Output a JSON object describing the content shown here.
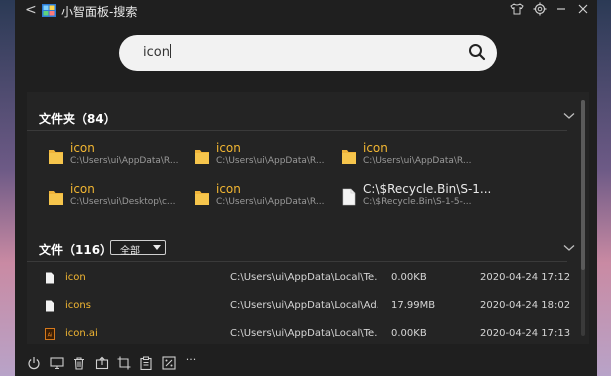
{
  "window": {
    "back_glyph": "<",
    "title": "小智面板-搜索",
    "icons": [
      "shirt-icon",
      "gear-icon",
      "minimize-icon",
      "close-icon"
    ]
  },
  "search": {
    "query": "icon"
  },
  "folders_section": {
    "title": "文件夹（84）",
    "items": [
      {
        "name": "icon",
        "path": "C:\\Users\\ui\\AppData\\R..."
      },
      {
        "name": "icon",
        "path": "C:\\Users\\ui\\AppData\\R..."
      },
      {
        "name": "icon",
        "path": "C:\\Users\\ui\\AppData\\R..."
      },
      {
        "name": "icon",
        "path": "C:\\Users\\ui\\Desktop\\c..."
      },
      {
        "name": "icon",
        "path": "C:\\Users\\ui\\AppData\\R..."
      },
      {
        "name": "C:\\$Recycle.Bin\\S-1...",
        "path": "C:\\$Recycle.Bin\\S-1-5-..."
      }
    ]
  },
  "files_section": {
    "title": "文件（116）",
    "filter": "全部",
    "rows": [
      {
        "name": "icon",
        "path": "C:\\Users\\ui\\AppData\\Local\\Te...",
        "size": "0.00KB",
        "date": "2020-04-24 17:12"
      },
      {
        "name": "icons",
        "path": "C:\\Users\\ui\\AppData\\Local\\Ad...",
        "size": "17.99MB",
        "date": "2020-04-24 18:02"
      },
      {
        "name": "icon.ai",
        "path": "C:\\Users\\ui\\AppData\\Local\\Te...",
        "size": "0.00KB",
        "date": "2020-04-24 17:13"
      }
    ]
  },
  "bottom_toolbar": {
    "icons": [
      "power-icon",
      "monitor-icon",
      "trash-icon",
      "export-icon",
      "crop-icon",
      "clipboard-icon",
      "percent-icon",
      "more-icon"
    ],
    "more_label": "···"
  },
  "colors": {
    "window_bg": "#1f1f1f",
    "panel_bg": "#242424",
    "accent_name": "#f2b632",
    "search_bg": "#f2f2f2"
  }
}
